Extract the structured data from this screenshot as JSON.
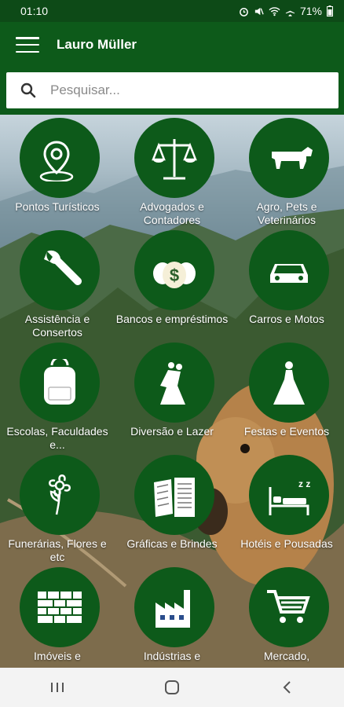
{
  "status_bar": {
    "time": "01:10",
    "battery": "71%"
  },
  "app_bar": {
    "title": "Lauro Müller"
  },
  "search": {
    "placeholder": "Pesquisar..."
  },
  "categories": [
    {
      "label": "Pontos Turísticos",
      "icon": "map-pin-icon"
    },
    {
      "label": "Advogados e Contadores",
      "icon": "scales-icon"
    },
    {
      "label": "Agro, Pets e Veterinários",
      "icon": "cow-icon"
    },
    {
      "label": "Assistência e Consertos",
      "icon": "wrench-icon"
    },
    {
      "label": "Bancos e empréstimos",
      "icon": "money-bags-icon"
    },
    {
      "label": "Carros e Motos",
      "icon": "car-icon"
    },
    {
      "label": "Escolas, Faculdades e...",
      "icon": "backpack-icon"
    },
    {
      "label": "Diversão e Lazer",
      "icon": "dancing-couple-icon"
    },
    {
      "label": "Festas e Eventos",
      "icon": "bride-icon"
    },
    {
      "label": "Funerárias, Flores e etc",
      "icon": "flower-icon"
    },
    {
      "label": "Gráficas e Brindes",
      "icon": "printed-pages-icon"
    },
    {
      "label": "Hotéis e Pousadas",
      "icon": "bed-icon"
    },
    {
      "label": "Imóveis e",
      "icon": "brick-wall-icon"
    },
    {
      "label": "Indústrias e",
      "icon": "factory-icon"
    },
    {
      "label": "Mercado,",
      "icon": "shopping-cart-icon"
    }
  ],
  "colors": {
    "primary": "#0d5a1a",
    "status_bar": "#0d4a17",
    "nav_bar": "#f3f3f3"
  }
}
